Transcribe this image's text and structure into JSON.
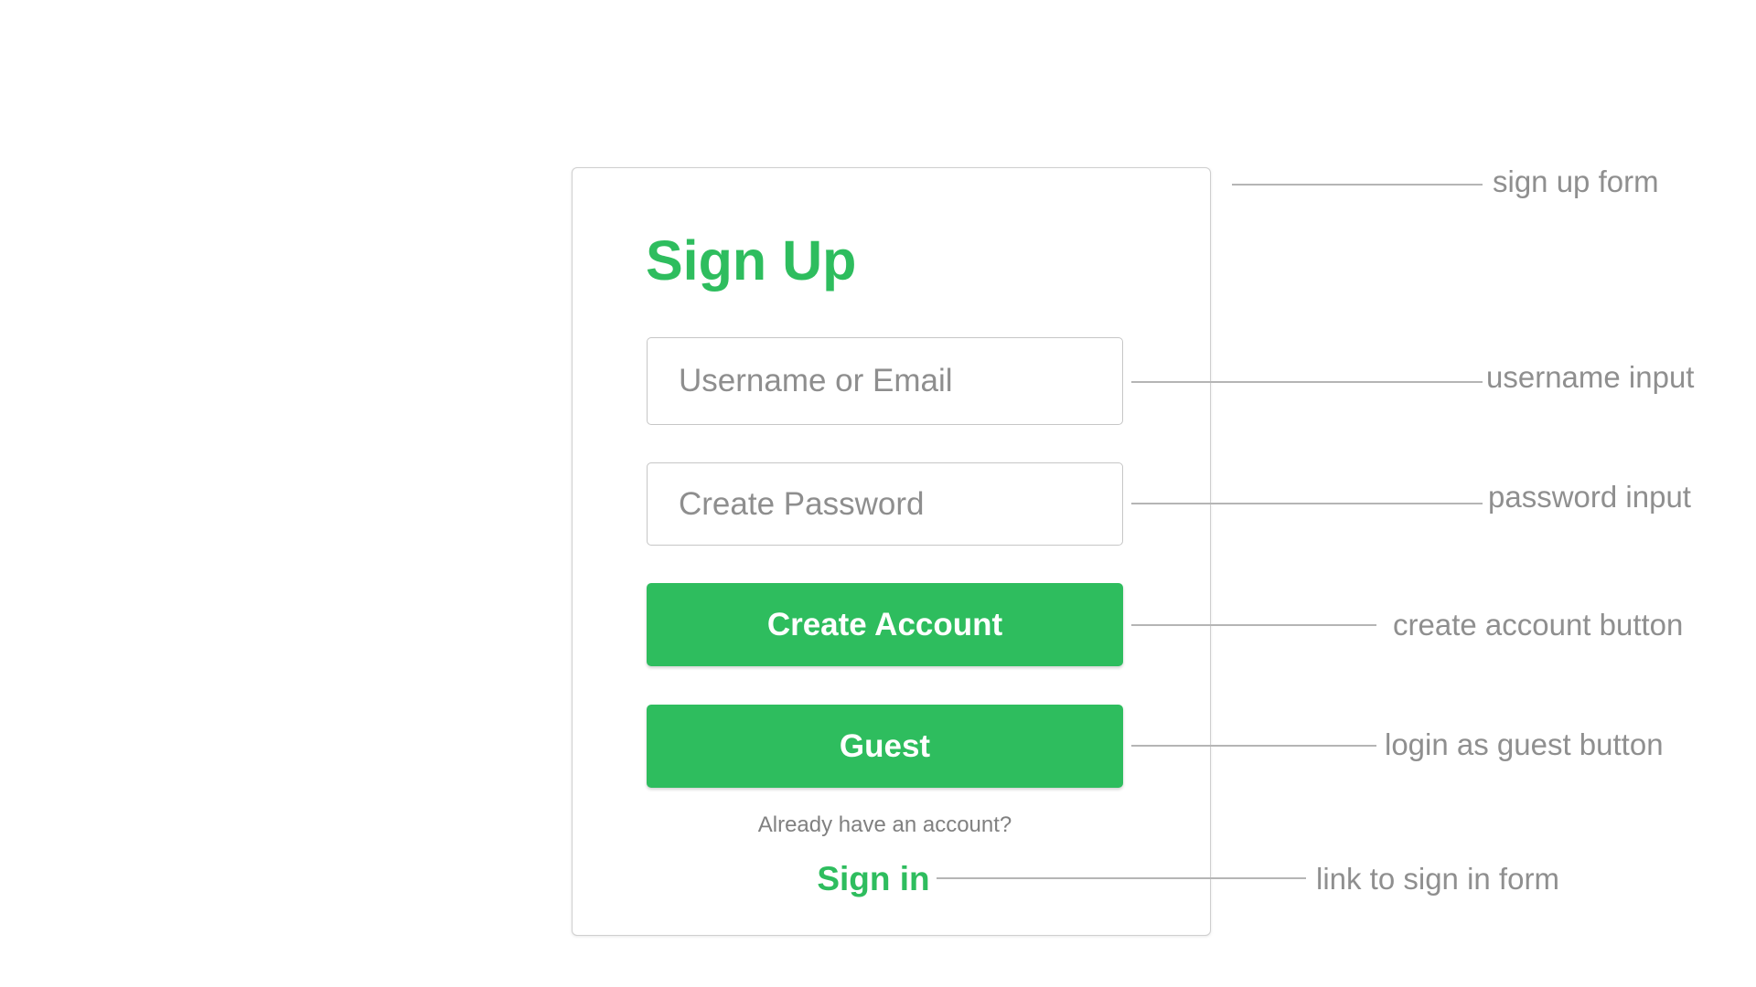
{
  "form": {
    "title": "Sign Up",
    "username_placeholder": "Username or Email",
    "password_placeholder": "Create Password",
    "create_account_label": "Create Account",
    "guest_label": "Guest",
    "helper_text": "Already have an account?",
    "sign_in_label": "Sign in",
    "accent_color": "#2ebd5e"
  },
  "annotations": {
    "sign_up_form": "sign up form",
    "username_input": "username input",
    "password_input": "password input",
    "create_account_button": "create account button",
    "guest_button": "login as guest button",
    "sign_in_link": "link to sign in form"
  }
}
